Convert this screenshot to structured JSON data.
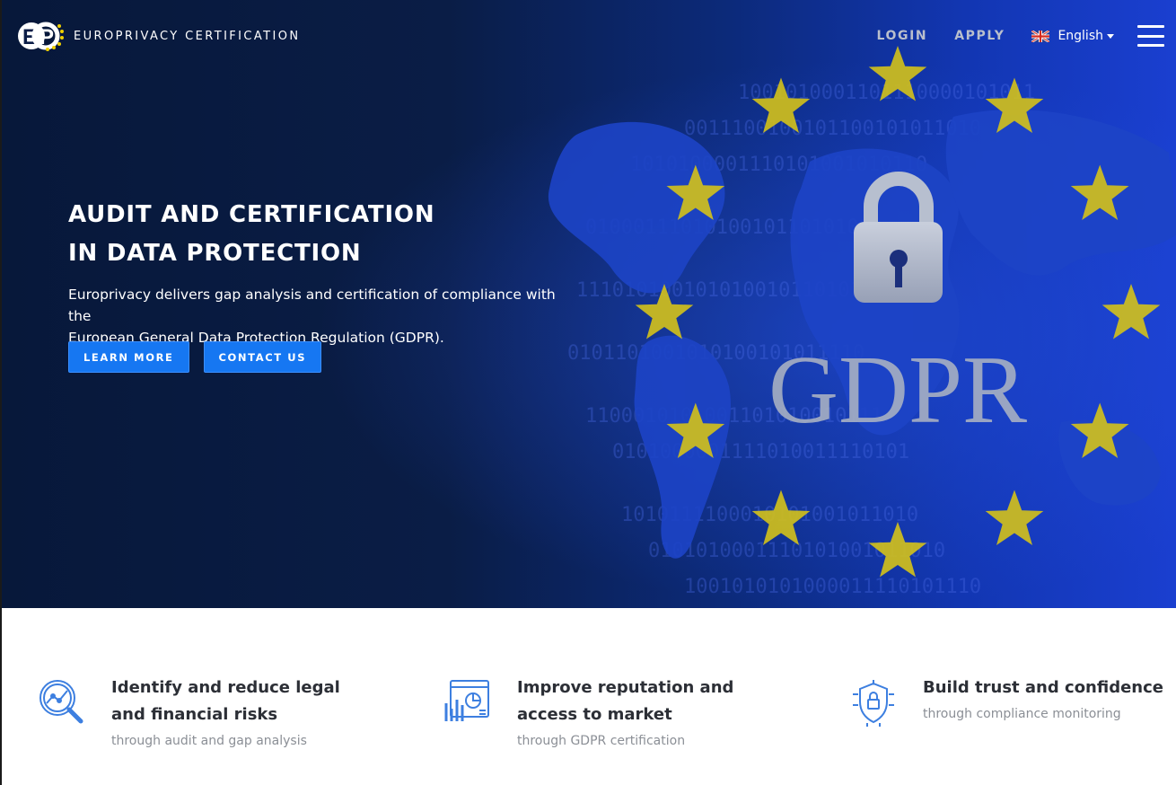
{
  "brand": {
    "name": "EUROPRIVACY CERTIFICATION",
    "logo_icon": "europrivacy-logo-icon"
  },
  "nav": {
    "login_label": "LOGIN",
    "apply_label": "APPLY",
    "language_label": "English",
    "language_icon": "uk-flag-icon",
    "menu_icon": "hamburger-menu-icon"
  },
  "hero": {
    "title_line1": "AUDIT AND CERTIFICATION",
    "title_line2": "IN DATA PROTECTION",
    "description_line1": "Europrivacy delivers gap analysis and certification of compliance with the",
    "description_line2": "European General Data Protection Regulation (GDPR).",
    "learn_more_label": "LEARN MORE",
    "contact_us_label": "CONTACT US",
    "image_text": "GDPR",
    "image_icons": [
      "padlock-icon",
      "eu-stars-circle",
      "world-map"
    ]
  },
  "features": [
    {
      "title_line1": "Identify and reduce legal",
      "title_line2": "and financial risks",
      "subtitle": "through audit and gap analysis",
      "icon": "magnifier-chart-icon"
    },
    {
      "title_line1": "Improve reputation and",
      "title_line2": "access to market",
      "subtitle": "through GDPR certification",
      "icon": "analytics-dashboard-icon"
    },
    {
      "title_line1": "Build trust and confidence",
      "title_line2": "",
      "subtitle": "through compliance monitoring",
      "icon": "shield-lock-icon"
    }
  ],
  "colors": {
    "accent_button": "#1677f2",
    "hero_dark": "#07183a",
    "hero_blue": "#1a3fd0",
    "star_yellow": "#d4c21a",
    "feature_icon": "#3d7fe0"
  }
}
